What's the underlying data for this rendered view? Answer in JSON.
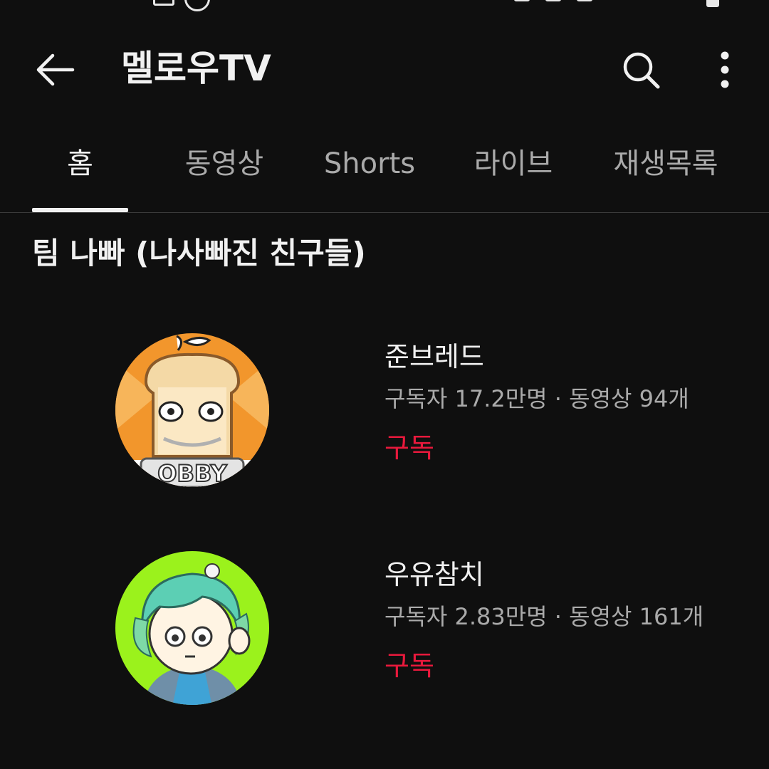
{
  "header": {
    "title": "멜로우TV"
  },
  "tabs": [
    {
      "label": "홈",
      "active": true
    },
    {
      "label": "동영상",
      "active": false
    },
    {
      "label": "Shorts",
      "active": false
    },
    {
      "label": "라이브",
      "active": false
    },
    {
      "label": "재생목록",
      "active": false
    }
  ],
  "section": {
    "title": "팀 나빠 (나사빠진 친구들)",
    "channels": [
      {
        "name": "준브레드",
        "meta": "구독자 17.2만명 · 동영상 94개",
        "subscribe_label": "구독",
        "avatar_text": "OBBY"
      },
      {
        "name": "우유참치",
        "meta": "구독자 2.83만명 · 동영상 161개",
        "subscribe_label": "구독"
      }
    ]
  },
  "colors": {
    "background": "#0f0f0f",
    "subscribe": "#e8193c",
    "secondary_text": "#aaaaaa"
  },
  "icons": {
    "back": "arrow-left-icon",
    "search": "search-icon",
    "more": "more-vertical-icon"
  }
}
